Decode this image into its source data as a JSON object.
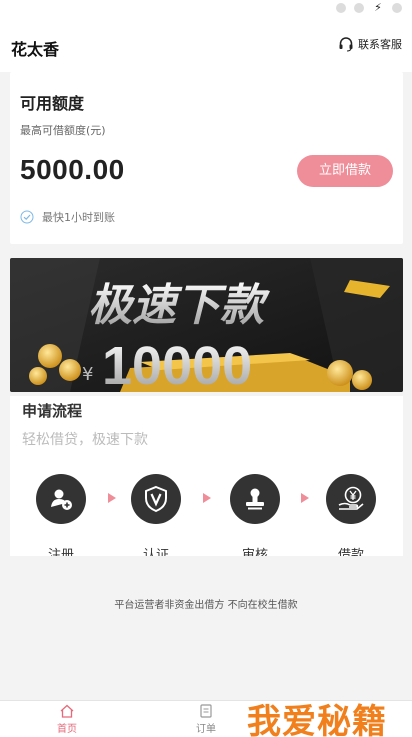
{
  "header": {
    "app_title": "花太香",
    "support_label": "联系客服"
  },
  "quota_card": {
    "title": "可用额度",
    "subtitle": "最高可借额度(元)",
    "amount": "5000.00",
    "borrow_button": "立即借款",
    "note": "最快1小时到账"
  },
  "banner": {
    "headline": "极速下款",
    "amount": "10000",
    "currency_symbol": "¥"
  },
  "process": {
    "title": "申请流程",
    "subtitle": "轻松借贷，极速下款",
    "steps": [
      {
        "label": "注册",
        "icon": "add-user-icon"
      },
      {
        "label": "认证",
        "icon": "verify-shield-icon"
      },
      {
        "label": "审核",
        "icon": "stamp-icon"
      },
      {
        "label": "借款",
        "icon": "yen-hand-icon"
      }
    ]
  },
  "disclaimer": "平台运营者非资金出借方 不向在校生借款",
  "tabbar": {
    "home_label": "首页",
    "orders_label": "订单"
  },
  "watermark": "我爱秘籍",
  "colors": {
    "accent": "#ef8d99",
    "tab_active": "#e56a7a",
    "watermark": "#f07f1c"
  }
}
